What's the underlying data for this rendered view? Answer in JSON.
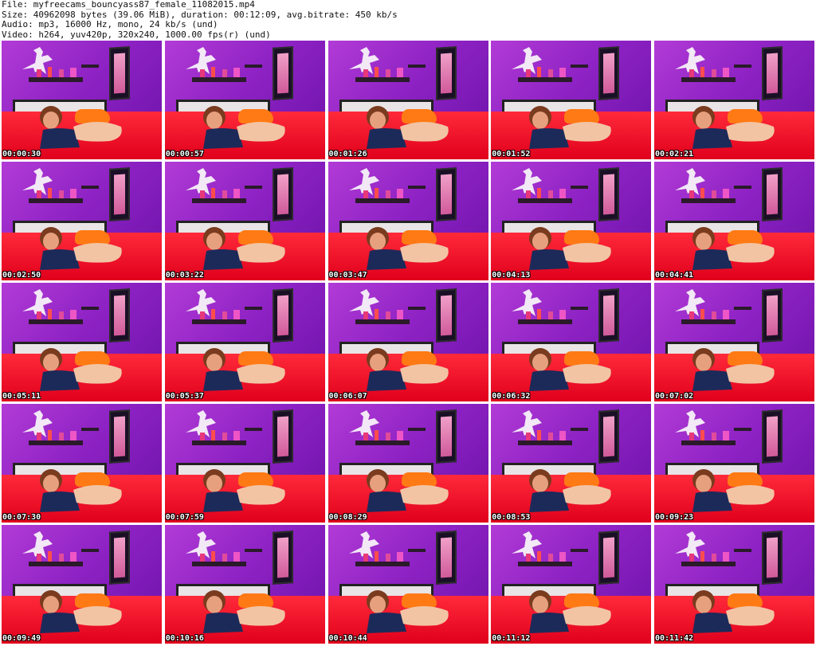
{
  "header": {
    "file_line": "File: myfreecams_bouncyass87_female_11082015.mp4",
    "size_line": "Size: 40962098 bytes (39.06 MiB), duration: 00:12:09, avg.bitrate: 450 kb/s",
    "audio_line": "Audio: mp3, 16000 Hz, mono, 24 kb/s (und)",
    "video_line": "Video: h264, yuv420p, 320x240, 1000.00 fps(r) (und)"
  },
  "thumbnails": [
    {
      "timestamp": "00:00:30"
    },
    {
      "timestamp": "00:00:57"
    },
    {
      "timestamp": "00:01:26"
    },
    {
      "timestamp": "00:01:52"
    },
    {
      "timestamp": "00:02:21"
    },
    {
      "timestamp": "00:02:50"
    },
    {
      "timestamp": "00:03:22"
    },
    {
      "timestamp": "00:03:47"
    },
    {
      "timestamp": "00:04:13"
    },
    {
      "timestamp": "00:04:41"
    },
    {
      "timestamp": "00:05:11"
    },
    {
      "timestamp": "00:05:37"
    },
    {
      "timestamp": "00:06:07"
    },
    {
      "timestamp": "00:06:32"
    },
    {
      "timestamp": "00:07:02"
    },
    {
      "timestamp": "00:07:30"
    },
    {
      "timestamp": "00:07:59"
    },
    {
      "timestamp": "00:08:29"
    },
    {
      "timestamp": "00:08:53"
    },
    {
      "timestamp": "00:09:23"
    },
    {
      "timestamp": "00:09:49"
    },
    {
      "timestamp": "00:10:16"
    },
    {
      "timestamp": "00:10:44"
    },
    {
      "timestamp": "00:11:12"
    },
    {
      "timestamp": "00:11:42"
    }
  ],
  "colors": {
    "wall": "#9a2fd0",
    "bed": "#f0101f",
    "pillow": "#ff7a14",
    "timestamp_text": "#ffffff"
  }
}
